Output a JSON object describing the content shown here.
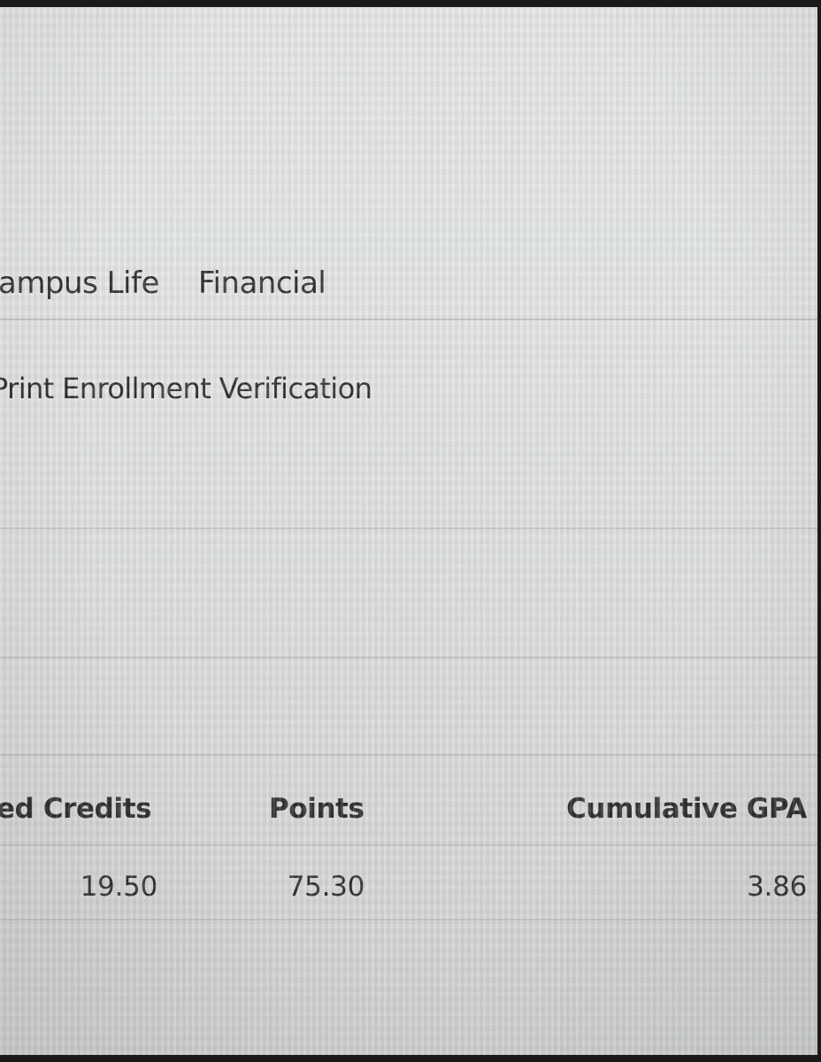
{
  "nav": {
    "items": [
      {
        "label": "ampus Life"
      },
      {
        "label": "Financial"
      }
    ]
  },
  "subnav": {
    "print_enrollment_label": "Print Enrollment Verification"
  },
  "gpa_table": {
    "headers": [
      "ed Credits",
      "Points",
      "Cumulative GPA"
    ],
    "row": [
      "19.50",
      "75.30",
      "3.86"
    ]
  }
}
